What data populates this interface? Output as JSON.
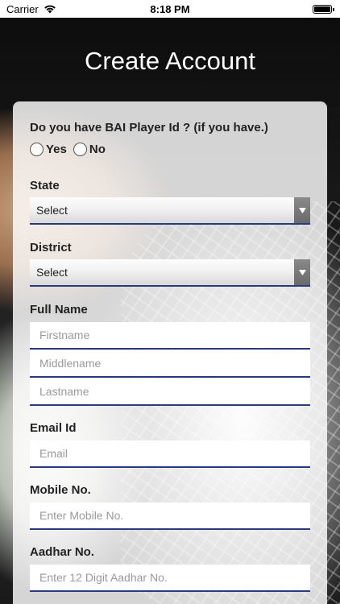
{
  "status_bar": {
    "carrier": "Carrier",
    "time": "8:18 PM"
  },
  "page": {
    "title": "Create Account"
  },
  "form": {
    "bai_question": "Do you have BAI Player Id ? (if you have.)",
    "bai_options": [
      "Yes",
      "No"
    ],
    "state": {
      "label": "State",
      "value": "Select"
    },
    "district": {
      "label": "District",
      "value": "Select"
    },
    "full_name": {
      "label": "Full Name",
      "first_placeholder": "Firstname",
      "middle_placeholder": "Middlename",
      "last_placeholder": "Lastname"
    },
    "email": {
      "label": "Email Id",
      "placeholder": "Email"
    },
    "mobile": {
      "label": "Mobile No.",
      "placeholder": "Enter Mobile No."
    },
    "aadhar": {
      "label": "Aadhar No.",
      "placeholder": "Enter 12 Digit Aadhar No."
    }
  }
}
